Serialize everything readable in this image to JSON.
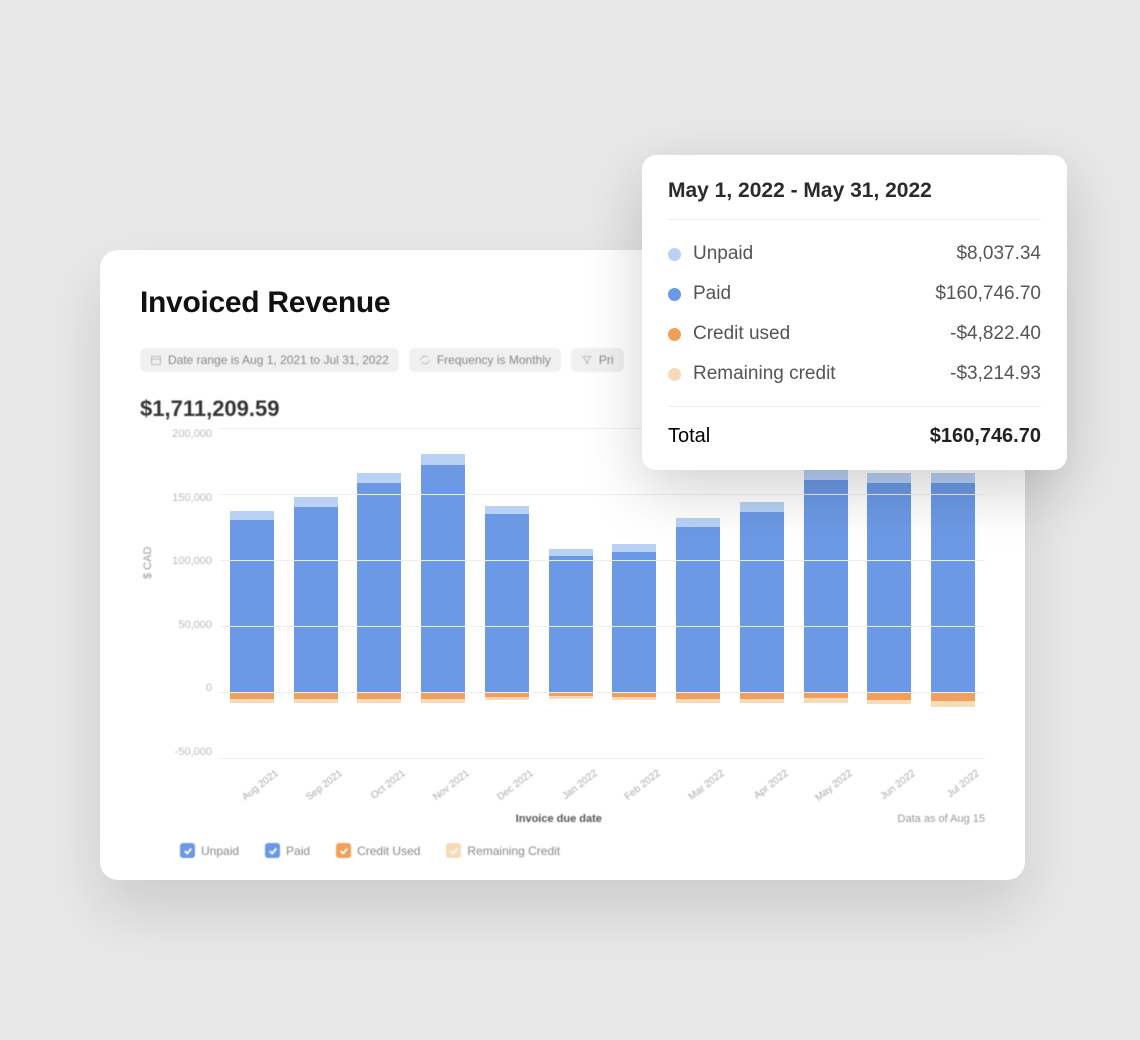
{
  "card": {
    "title": "Invoiced Revenue",
    "chips": {
      "date_range": "Date range is Aug 1, 2021 to Jul 31, 2022",
      "frequency": "Frequency is Monthly",
      "filter": "Pri"
    },
    "total": "$1,711,209.59"
  },
  "tooltip": {
    "range": "May 1, 2022 - May 31, 2022",
    "rows": [
      {
        "label": "Unpaid",
        "value": "$8,037.34",
        "color": "#b8d1f5"
      },
      {
        "label": "Paid",
        "value": "$160,746.70",
        "color": "#6c99e6"
      },
      {
        "label": "Credit used",
        "value": "-$4,822.40",
        "color": "#f0a05a"
      },
      {
        "label": "Remaining credit",
        "value": "-$3,214.93",
        "color": "#f7dbb8"
      }
    ],
    "total_label": "Total",
    "total_value": "$160,746.70"
  },
  "legend": [
    {
      "label": "Unpaid",
      "color": "#6c99e6"
    },
    {
      "label": "Paid",
      "color": "#6c99e6"
    },
    {
      "label": "Credit Used",
      "color": "#f0a05a"
    },
    {
      "label": "Remaining Credit",
      "color": "#f7dbb8"
    }
  ],
  "axes": {
    "ylabel": "$ CAD",
    "xlabel": "Invoice due date",
    "data_as_of": "Data as of Aug 15"
  },
  "chart_data": {
    "type": "bar",
    "title": "Invoiced Revenue",
    "xlabel": "Invoice due date",
    "ylabel": "$ CAD",
    "ylim": [
      -50000,
      200000
    ],
    "y_ticks": [
      -50000,
      0,
      50000,
      100000,
      150000,
      200000
    ],
    "y_tick_labels": [
      "-50,000",
      "0",
      "50,000",
      "100,000",
      "150,000",
      "200,000"
    ],
    "categories": [
      "Aug 2021",
      "Sep 2021",
      "Oct 2021",
      "Nov 2021",
      "Dec 2021",
      "Jan 2022",
      "Feb 2022",
      "Mar 2022",
      "Apr 2022",
      "May 2022",
      "Jun 2022",
      "Jul 2022"
    ],
    "series": [
      {
        "name": "Unpaid",
        "color": "#b8d1f5",
        "values": [
          7000,
          8000,
          8000,
          8000,
          6000,
          5000,
          6000,
          7000,
          8000,
          8037.34,
          8000,
          8000
        ]
      },
      {
        "name": "Paid",
        "color": "#6c99e6",
        "values": [
          130000,
          140000,
          158000,
          172000,
          135000,
          103000,
          106000,
          125000,
          136000,
          160746.7,
          158000,
          158000
        ]
      },
      {
        "name": "Credit used",
        "color": "#f0a05a",
        "values": [
          -5000,
          -5000,
          -5000,
          -5000,
          -4000,
          -3000,
          -4000,
          -5000,
          -5000,
          -4822.4,
          -6000,
          -7000
        ]
      },
      {
        "name": "Remaining credit",
        "color": "#f7dbb8",
        "values": [
          -3000,
          -3000,
          -3000,
          -3000,
          -2000,
          -2000,
          -2000,
          -3000,
          -3000,
          -3214.93,
          -3000,
          -4000
        ]
      }
    ]
  }
}
